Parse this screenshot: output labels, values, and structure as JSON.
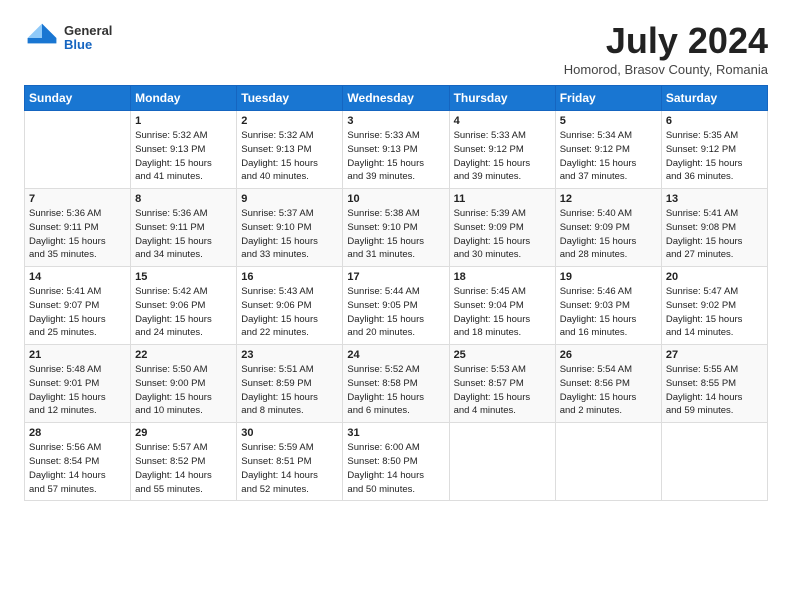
{
  "logo": {
    "general": "General",
    "blue": "Blue"
  },
  "title": "July 2024",
  "location": "Homorod, Brasov County, Romania",
  "weekdays": [
    "Sunday",
    "Monday",
    "Tuesday",
    "Wednesday",
    "Thursday",
    "Friday",
    "Saturday"
  ],
  "weeks": [
    [
      {
        "day": "",
        "info": ""
      },
      {
        "day": "1",
        "info": "Sunrise: 5:32 AM\nSunset: 9:13 PM\nDaylight: 15 hours\nand 41 minutes."
      },
      {
        "day": "2",
        "info": "Sunrise: 5:32 AM\nSunset: 9:13 PM\nDaylight: 15 hours\nand 40 minutes."
      },
      {
        "day": "3",
        "info": "Sunrise: 5:33 AM\nSunset: 9:13 PM\nDaylight: 15 hours\nand 39 minutes."
      },
      {
        "day": "4",
        "info": "Sunrise: 5:33 AM\nSunset: 9:12 PM\nDaylight: 15 hours\nand 39 minutes."
      },
      {
        "day": "5",
        "info": "Sunrise: 5:34 AM\nSunset: 9:12 PM\nDaylight: 15 hours\nand 37 minutes."
      },
      {
        "day": "6",
        "info": "Sunrise: 5:35 AM\nSunset: 9:12 PM\nDaylight: 15 hours\nand 36 minutes."
      }
    ],
    [
      {
        "day": "7",
        "info": "Sunrise: 5:36 AM\nSunset: 9:11 PM\nDaylight: 15 hours\nand 35 minutes."
      },
      {
        "day": "8",
        "info": "Sunrise: 5:36 AM\nSunset: 9:11 PM\nDaylight: 15 hours\nand 34 minutes."
      },
      {
        "day": "9",
        "info": "Sunrise: 5:37 AM\nSunset: 9:10 PM\nDaylight: 15 hours\nand 33 minutes."
      },
      {
        "day": "10",
        "info": "Sunrise: 5:38 AM\nSunset: 9:10 PM\nDaylight: 15 hours\nand 31 minutes."
      },
      {
        "day": "11",
        "info": "Sunrise: 5:39 AM\nSunset: 9:09 PM\nDaylight: 15 hours\nand 30 minutes."
      },
      {
        "day": "12",
        "info": "Sunrise: 5:40 AM\nSunset: 9:09 PM\nDaylight: 15 hours\nand 28 minutes."
      },
      {
        "day": "13",
        "info": "Sunrise: 5:41 AM\nSunset: 9:08 PM\nDaylight: 15 hours\nand 27 minutes."
      }
    ],
    [
      {
        "day": "14",
        "info": "Sunrise: 5:41 AM\nSunset: 9:07 PM\nDaylight: 15 hours\nand 25 minutes."
      },
      {
        "day": "15",
        "info": "Sunrise: 5:42 AM\nSunset: 9:06 PM\nDaylight: 15 hours\nand 24 minutes."
      },
      {
        "day": "16",
        "info": "Sunrise: 5:43 AM\nSunset: 9:06 PM\nDaylight: 15 hours\nand 22 minutes."
      },
      {
        "day": "17",
        "info": "Sunrise: 5:44 AM\nSunset: 9:05 PM\nDaylight: 15 hours\nand 20 minutes."
      },
      {
        "day": "18",
        "info": "Sunrise: 5:45 AM\nSunset: 9:04 PM\nDaylight: 15 hours\nand 18 minutes."
      },
      {
        "day": "19",
        "info": "Sunrise: 5:46 AM\nSunset: 9:03 PM\nDaylight: 15 hours\nand 16 minutes."
      },
      {
        "day": "20",
        "info": "Sunrise: 5:47 AM\nSunset: 9:02 PM\nDaylight: 15 hours\nand 14 minutes."
      }
    ],
    [
      {
        "day": "21",
        "info": "Sunrise: 5:48 AM\nSunset: 9:01 PM\nDaylight: 15 hours\nand 12 minutes."
      },
      {
        "day": "22",
        "info": "Sunrise: 5:50 AM\nSunset: 9:00 PM\nDaylight: 15 hours\nand 10 minutes."
      },
      {
        "day": "23",
        "info": "Sunrise: 5:51 AM\nSunset: 8:59 PM\nDaylight: 15 hours\nand 8 minutes."
      },
      {
        "day": "24",
        "info": "Sunrise: 5:52 AM\nSunset: 8:58 PM\nDaylight: 15 hours\nand 6 minutes."
      },
      {
        "day": "25",
        "info": "Sunrise: 5:53 AM\nSunset: 8:57 PM\nDaylight: 15 hours\nand 4 minutes."
      },
      {
        "day": "26",
        "info": "Sunrise: 5:54 AM\nSunset: 8:56 PM\nDaylight: 15 hours\nand 2 minutes."
      },
      {
        "day": "27",
        "info": "Sunrise: 5:55 AM\nSunset: 8:55 PM\nDaylight: 14 hours\nand 59 minutes."
      }
    ],
    [
      {
        "day": "28",
        "info": "Sunrise: 5:56 AM\nSunset: 8:54 PM\nDaylight: 14 hours\nand 57 minutes."
      },
      {
        "day": "29",
        "info": "Sunrise: 5:57 AM\nSunset: 8:52 PM\nDaylight: 14 hours\nand 55 minutes."
      },
      {
        "day": "30",
        "info": "Sunrise: 5:59 AM\nSunset: 8:51 PM\nDaylight: 14 hours\nand 52 minutes."
      },
      {
        "day": "31",
        "info": "Sunrise: 6:00 AM\nSunset: 8:50 PM\nDaylight: 14 hours\nand 50 minutes."
      },
      {
        "day": "",
        "info": ""
      },
      {
        "day": "",
        "info": ""
      },
      {
        "day": "",
        "info": ""
      }
    ]
  ]
}
